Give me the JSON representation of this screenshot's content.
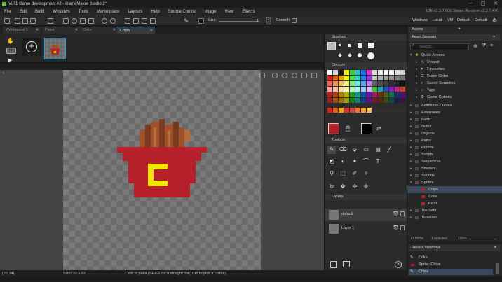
{
  "window": {
    "title": "VIR1 Game development #2 - GameMaker Studio 2*",
    "minimize": "─",
    "maximize": "▢",
    "close": "✕"
  },
  "menu": {
    "items": [
      "File",
      "Edit",
      "Build",
      "Windows",
      "Tools",
      "Marketplace",
      "Layouts",
      "Help",
      "Source Control",
      "Image",
      "View",
      "Effects"
    ],
    "version": "IDE v2.3.7.606 Steam  Runtime v2.3.7.476"
  },
  "toolbar": {
    "size_label": "Size:",
    "size_value": "1",
    "smooth_label": "Smooth",
    "layout_links": [
      "Windows",
      "Local",
      "VM",
      "Default",
      "Default"
    ]
  },
  "tabs": [
    {
      "label": "Workspace 1",
      "active": false
    },
    {
      "label": "Pizza",
      "active": false
    },
    {
      "label": "Coke",
      "active": false
    },
    {
      "label": "Chips",
      "active": true
    }
  ],
  "panels": {
    "brushes": "Brushes",
    "colours": "Colours",
    "toolbox": "Toolbox",
    "layers": "Layers"
  },
  "layers": [
    {
      "name": "default"
    },
    {
      "name": "Layer 1"
    }
  ],
  "palette": {
    "rows": [
      [
        "#ffffff",
        "#d8d8d8",
        "#1a1a1a",
        "#f4f400",
        "#34d034",
        "#26c6c6",
        "#1a6af0",
        "#e62ad4",
        "#d9d9d9",
        "#ececec",
        "#ffffff",
        "#f2f2f2",
        "#e0e0e0",
        "#cfcfcf"
      ],
      [
        "#e02020",
        "#e06010",
        "#f0a000",
        "#f0f000",
        "#40e040",
        "#20e0c0",
        "#2080f0",
        "#a030f0",
        "#c0c0c0",
        "#b0b0b0",
        "#a0a0a0",
        "#909090",
        "#808080",
        "#707070"
      ],
      [
        "#f06060",
        "#f09060",
        "#f0c060",
        "#f0f080",
        "#80f080",
        "#60f0e0",
        "#60a0f0",
        "#c080f0",
        "#606060",
        "#505050",
        "#404040",
        "#303030",
        "#202020",
        "#101010"
      ],
      [
        "#f8a0a0",
        "#f8c0a0",
        "#f8e0a0",
        "#f8f8b0",
        "#b0f8b0",
        "#a0f8f0",
        "#a0c8f8",
        "#e0b0f8",
        "#40c040",
        "#20a0a0",
        "#2050c0",
        "#8020c0",
        "#c02080",
        "#c04020"
      ],
      [
        "#b02020",
        "#b04010",
        "#b08000",
        "#b0b000",
        "#20a020",
        "#10a090",
        "#1050b0",
        "#7010b0",
        "#a01860",
        "#703010",
        "#506010",
        "#107050",
        "#103070",
        "#501070"
      ],
      [
        "#a02020",
        "#a05010",
        "#a07000",
        "#a0a010",
        "#108010",
        "#108070",
        "#104090",
        "#601090",
        "#7a1830",
        "#5a2a10",
        "#3a4a10",
        "#104a3a",
        "#10204a",
        "#3a104a"
      ]
    ],
    "recent": [
      "#e02020",
      "#e06010",
      "#f0a000",
      "#d93030",
      "#c84040",
      "#e87030",
      "#f0a040",
      "#f8c060",
      "#303030",
      "#303030",
      "#303030",
      "#303030",
      "#303030",
      "#303030"
    ],
    "primary": "#b5202a",
    "secondary": "#000000"
  },
  "assets": {
    "tab_label": "Assets",
    "browser_label": "Asset Browser",
    "search_placeholder": "Search...",
    "quick_access": "Quick Access",
    "quick_items": [
      "Recent",
      "Favourites",
      "Room Order",
      "Saved Searches",
      "Tags",
      "Game Options"
    ],
    "folders": [
      "Animation Curves",
      "Extensions",
      "Fonts",
      "Notes",
      "Objects",
      "Paths",
      "Rooms",
      "Scripts",
      "Sequences",
      "Shaders",
      "Sounds",
      "Sprites"
    ],
    "sprites": [
      "Chips",
      "Coke",
      "Pizza"
    ],
    "folders_after": [
      "Tile Sets",
      "Timelines"
    ],
    "footer_count": "17 items",
    "footer_selected": "1 selected",
    "footer_zoom": "100%"
  },
  "recent_windows": {
    "title": "Recent Windows",
    "items": [
      "Coke",
      "Sprite: Chips",
      "Chips"
    ]
  },
  "status": {
    "coords": "(20,14)",
    "size": "Size: 32 x 32",
    "hint": "Click to paint (SHIFT for a straight line, Ctrl to pick a colour)"
  },
  "colors": {
    "accent": "#3aa0e0",
    "fries": "#a0522d",
    "carton": "#b5202a",
    "logo": "#f2e600"
  }
}
